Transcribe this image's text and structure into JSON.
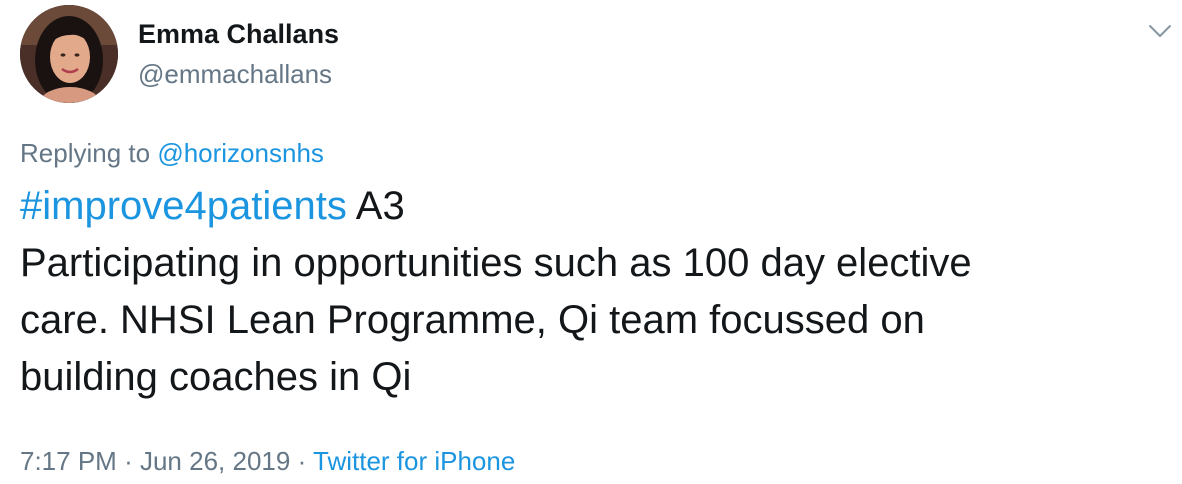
{
  "author": {
    "display_name": "Emma Challans",
    "handle": "@emmachallans"
  },
  "reply": {
    "prefix": "Replying to",
    "target": "@horizonsnhs"
  },
  "tweet": {
    "hashtag": "#improve4patients",
    "after_hashtag": "A3",
    "line2": "Participating in opportunities such as 100 day elective",
    "line3": "care. NHSI Lean Programme, Qi team focussed on",
    "line4": "building coaches in Qi"
  },
  "meta": {
    "time": "7:17 PM",
    "separator": "·",
    "date": "Jun 26, 2019",
    "source": "Twitter for iPhone"
  },
  "icons": {
    "caret": "chevron-down-icon",
    "avatar": "profile-photo"
  },
  "colors": {
    "link": "#1b95e0",
    "secondary": "#657786",
    "text": "#14171a"
  }
}
